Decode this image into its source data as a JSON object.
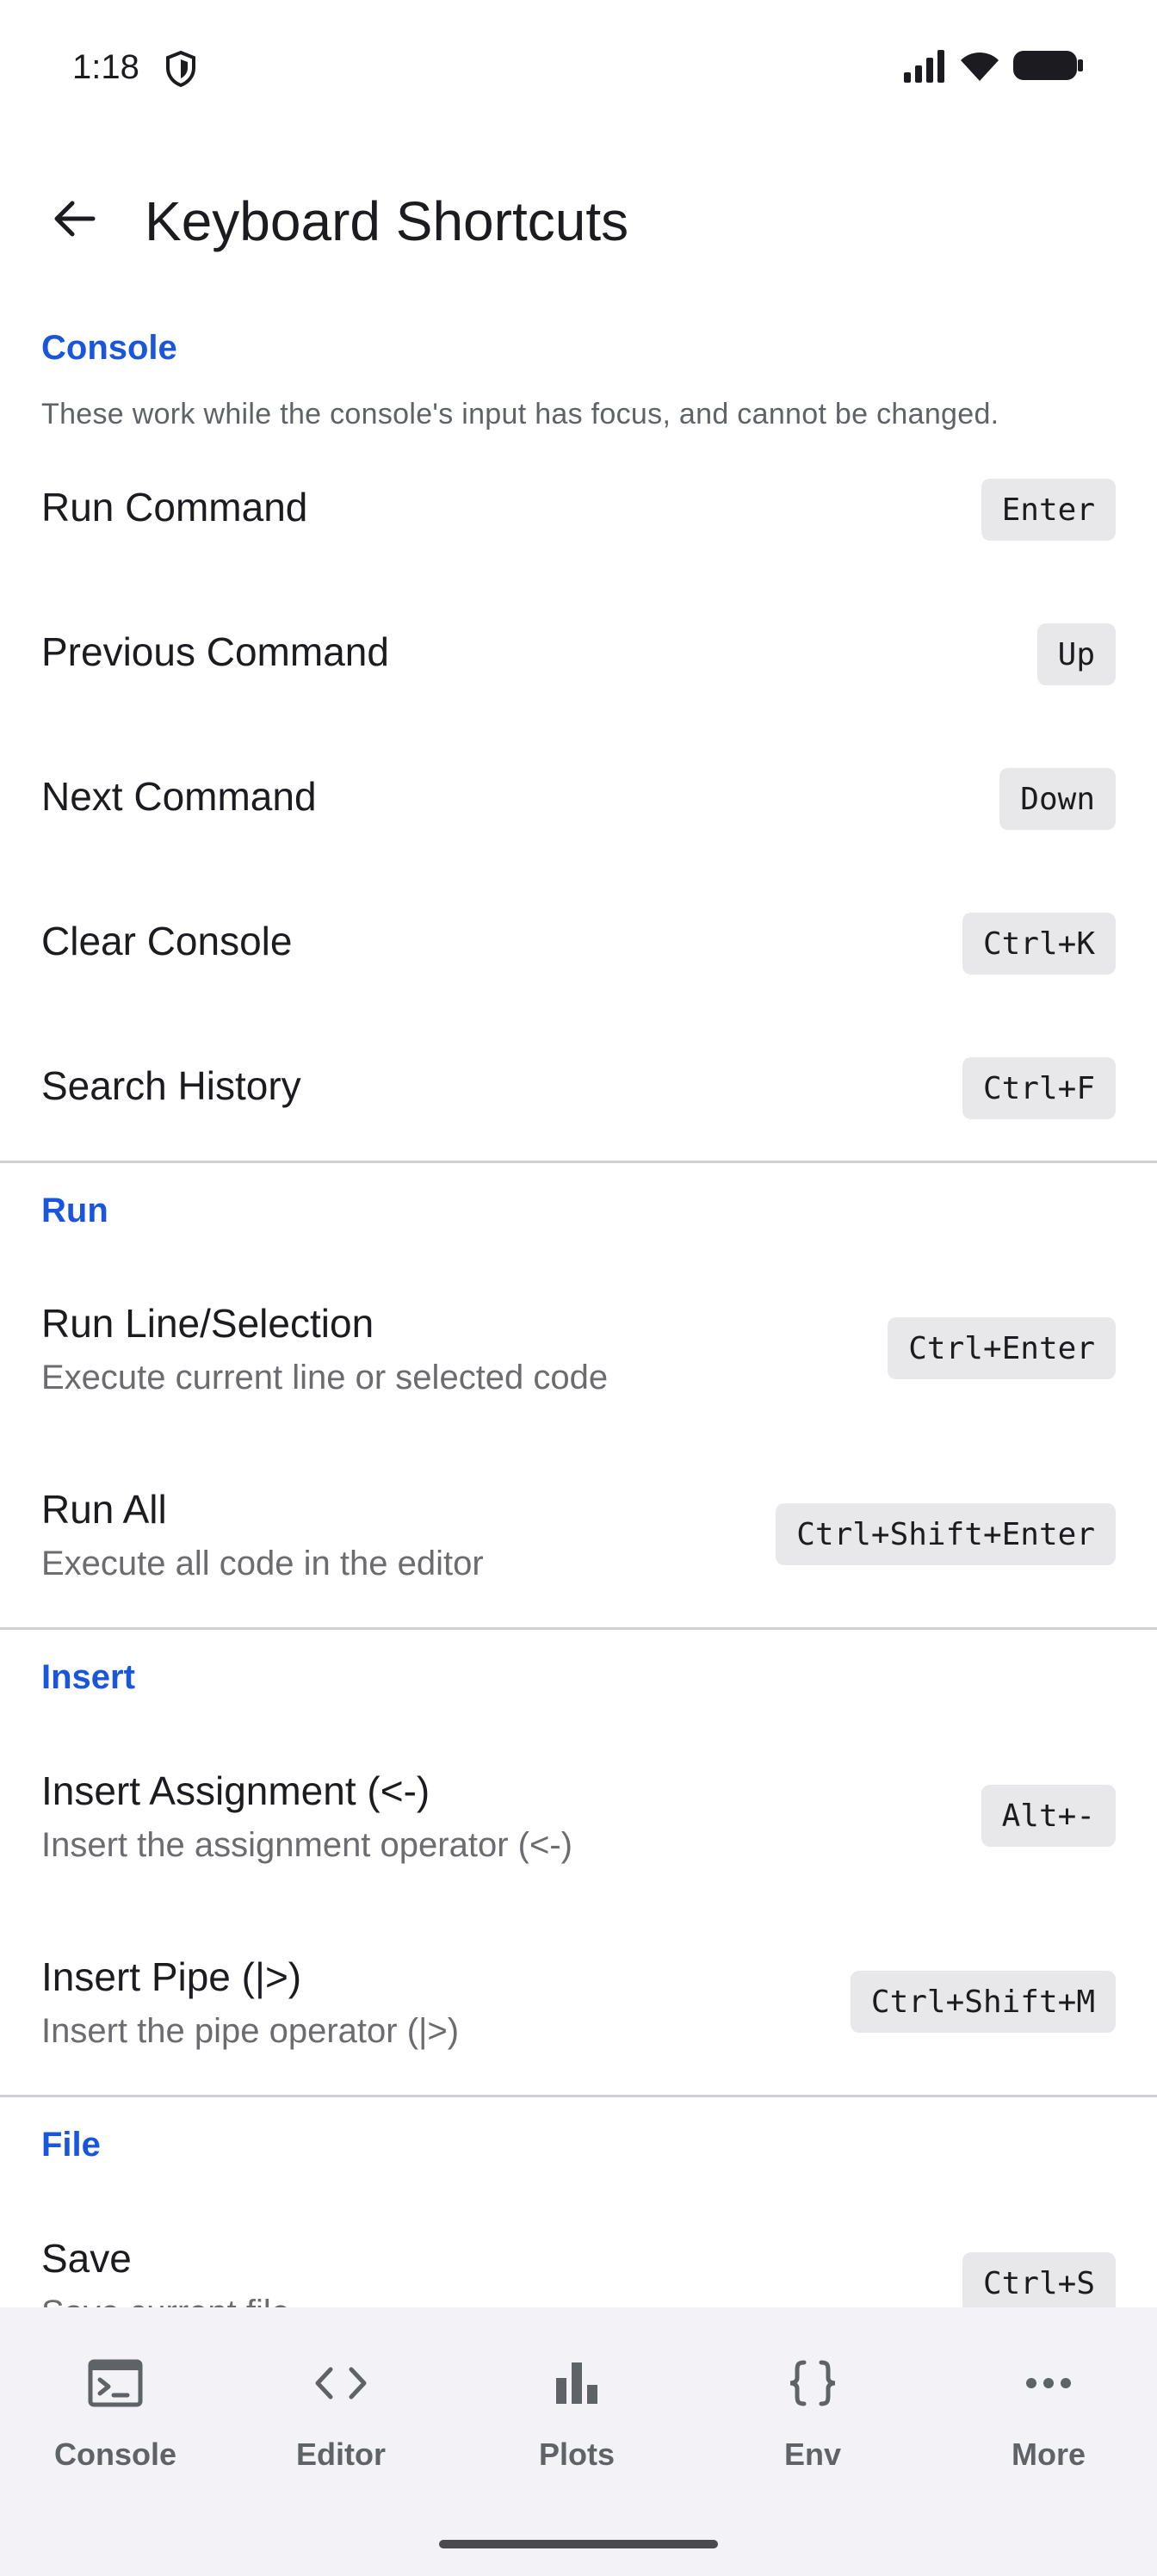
{
  "status_bar": {
    "time": "1:18"
  },
  "app_bar": {
    "title": "Keyboard Shortcuts"
  },
  "sections": {
    "console": {
      "header": "Console",
      "note": "These work while the console's input has focus, and cannot be changed.",
      "items": [
        {
          "title": "Run Command",
          "key": "Enter"
        },
        {
          "title": "Previous Command",
          "key": "Up"
        },
        {
          "title": "Next Command",
          "key": "Down"
        },
        {
          "title": "Clear Console",
          "key": "Ctrl+K"
        },
        {
          "title": "Search History",
          "key": "Ctrl+F"
        }
      ]
    },
    "run": {
      "header": "Run",
      "items": [
        {
          "title": "Run Line/Selection",
          "subtitle": "Execute current line or selected code",
          "key": "Ctrl+Enter"
        },
        {
          "title": "Run All",
          "subtitle": "Execute all code in the editor",
          "key": "Ctrl+Shift+Enter"
        }
      ]
    },
    "insert": {
      "header": "Insert",
      "items": [
        {
          "title": "Insert Assignment (<-)",
          "subtitle": "Insert the assignment operator (<-)",
          "key": "Alt+-"
        },
        {
          "title": "Insert Pipe (|>)",
          "subtitle": "Insert the pipe operator (|>)",
          "key": "Ctrl+Shift+M"
        }
      ]
    },
    "file": {
      "header": "File",
      "items": [
        {
          "title": "Save",
          "subtitle": "Save current file",
          "key": "Ctrl+S"
        }
      ]
    }
  },
  "bottom_nav": {
    "items": [
      {
        "label": "Console",
        "icon": "terminal-icon"
      },
      {
        "label": "Editor",
        "icon": "code-icon"
      },
      {
        "label": "Plots",
        "icon": "bar-chart-icon"
      },
      {
        "label": "Env",
        "icon": "braces-icon"
      },
      {
        "label": "More",
        "icon": "more-horizontal-icon"
      }
    ]
  },
  "colors": {
    "accent": "#1a56db",
    "key_bg": "#e8e8ea",
    "nav_bg": "#f3f2f7"
  }
}
